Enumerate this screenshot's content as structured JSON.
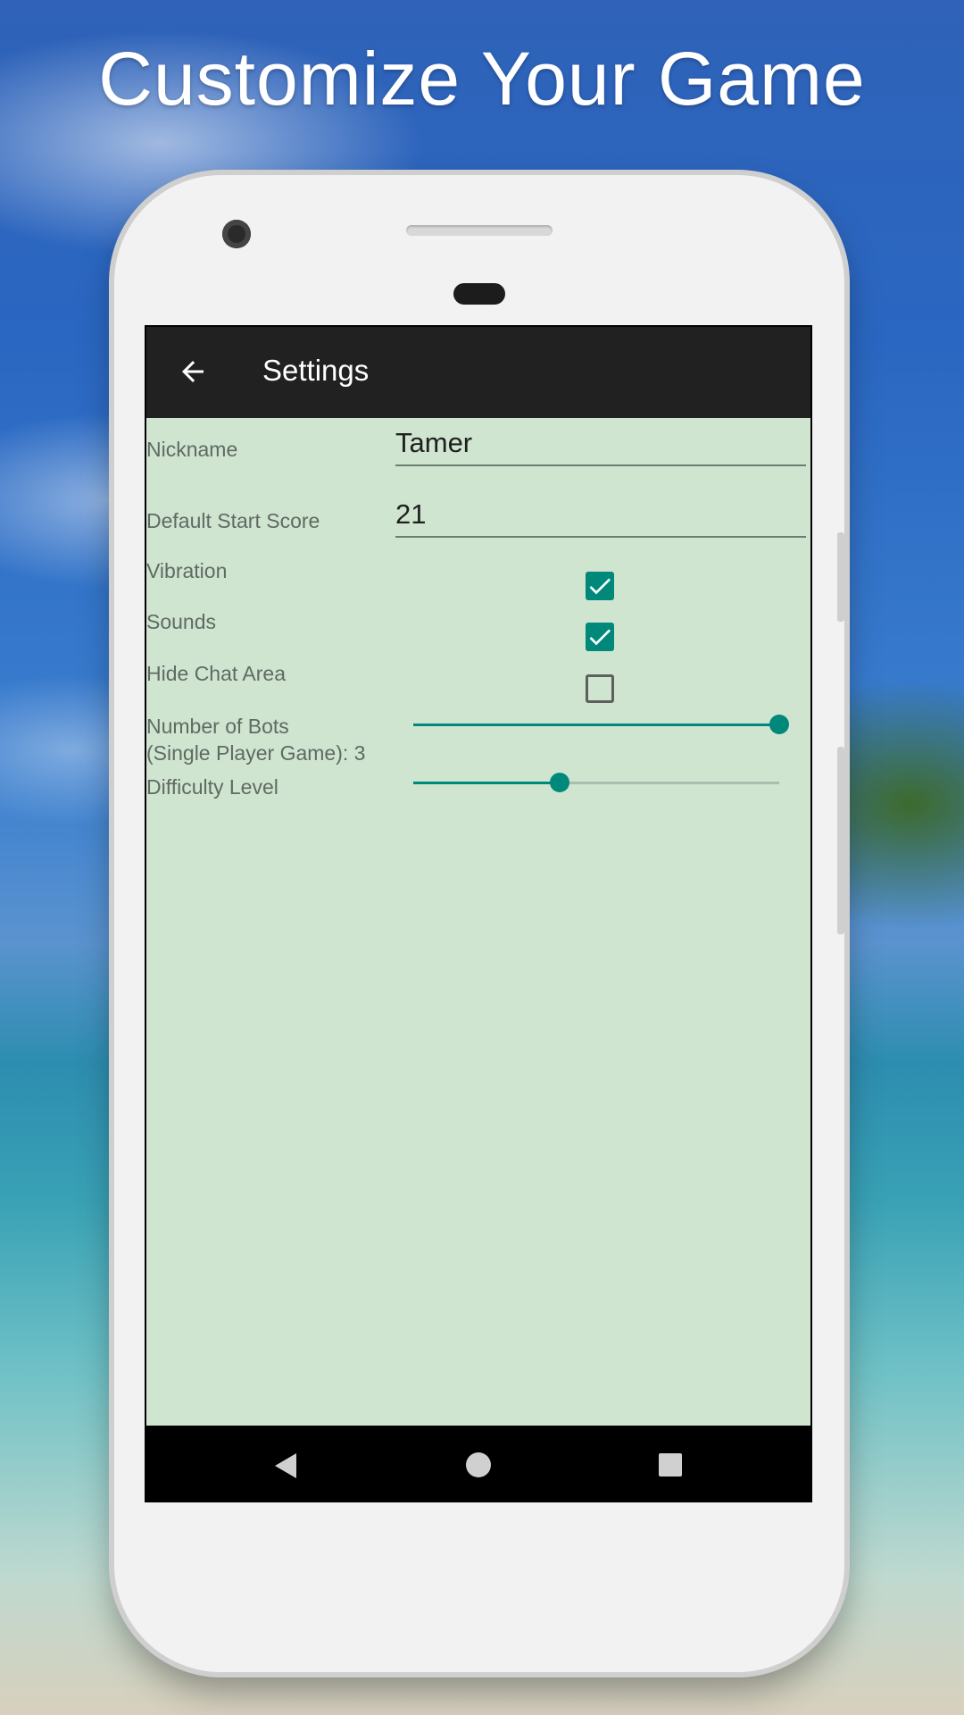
{
  "headline": "Customize Your Game",
  "appbar": {
    "title": "Settings",
    "back_icon": "arrow-left-icon"
  },
  "settings": {
    "nickname": {
      "label": "Nickname",
      "value": "Tamer"
    },
    "start_score": {
      "label": "Default Start Score",
      "value": "21"
    },
    "vibration": {
      "label": "Vibration",
      "checked": true
    },
    "sounds": {
      "label": "Sounds",
      "checked": true
    },
    "hide_chat": {
      "label": "Hide Chat Area",
      "checked": false
    },
    "bots": {
      "label_line1": "Number of Bots",
      "label_line2": "(Single Player Game): 3",
      "slider_fraction": 1.0
    },
    "difficulty": {
      "label": "Difficulty Level",
      "slider_fraction": 0.4
    }
  },
  "navbar": {
    "icons": [
      "back-triangle-icon",
      "home-circle-icon",
      "recents-square-icon"
    ]
  },
  "colors": {
    "accent": "#00897b",
    "content_bg": "#cfe5d0",
    "appbar_bg": "#212121"
  }
}
